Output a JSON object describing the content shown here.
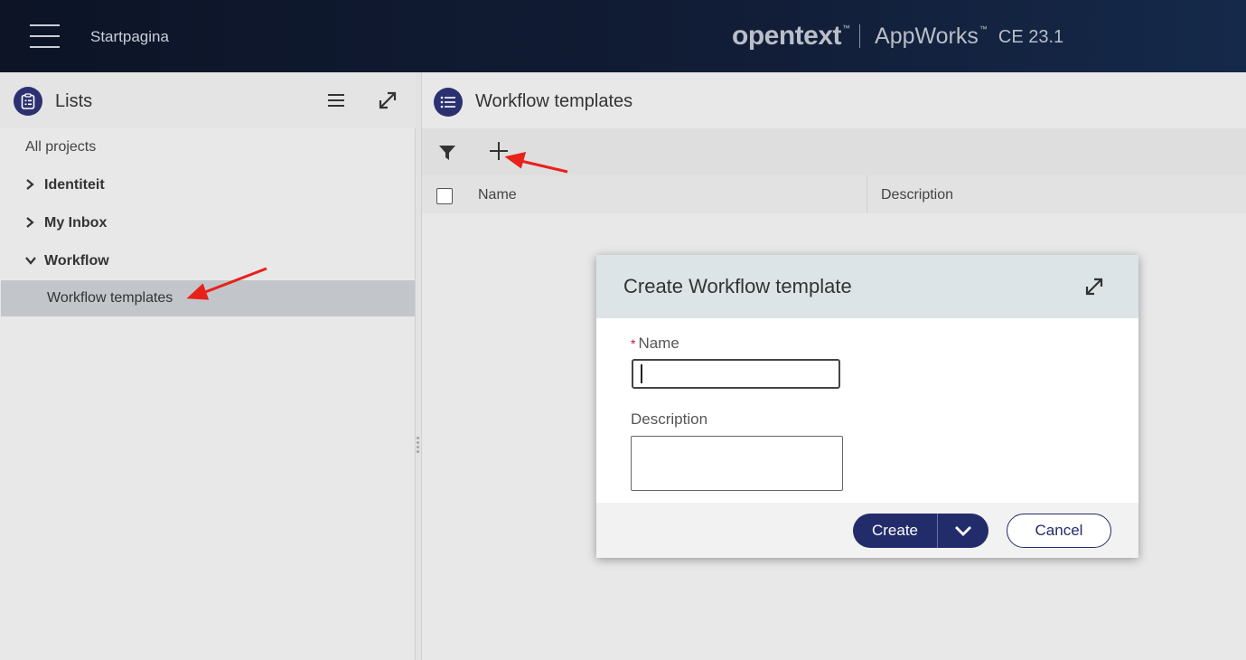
{
  "topbar": {
    "home_title": "Startpagina",
    "brand_logo": "opentext",
    "brand_tm": "™",
    "product": "AppWorks",
    "product_tm": "™",
    "version": "CE 23.1"
  },
  "left_panel": {
    "title": "Lists",
    "items": [
      {
        "label": "All projects"
      },
      {
        "label": "Identiteit",
        "chevron": "›"
      },
      {
        "label": "My Inbox",
        "chevron": "›"
      },
      {
        "label": "Workflow",
        "chevron": "⌄"
      },
      {
        "label": "Workflow templates"
      }
    ]
  },
  "right_panel": {
    "title": "Workflow templates",
    "columns": {
      "name": "Name",
      "description": "Description"
    }
  },
  "dialog": {
    "title": "Create Workflow template",
    "required_mark": "*",
    "name_label": "Name",
    "name_value": "",
    "description_label": "Description",
    "description_value": "",
    "create_label": "Create",
    "cancel_label": "Cancel"
  },
  "colors": {
    "accent": "#232c6b",
    "topbar": "#0f1830",
    "selected_row": "#c2c6cb",
    "annotation_arrow": "#e8211b"
  },
  "icons": [
    "menu-icon",
    "clipboard-icon",
    "list-icon",
    "expand-icon",
    "filter-icon",
    "add-icon",
    "chevron-down-icon"
  ]
}
